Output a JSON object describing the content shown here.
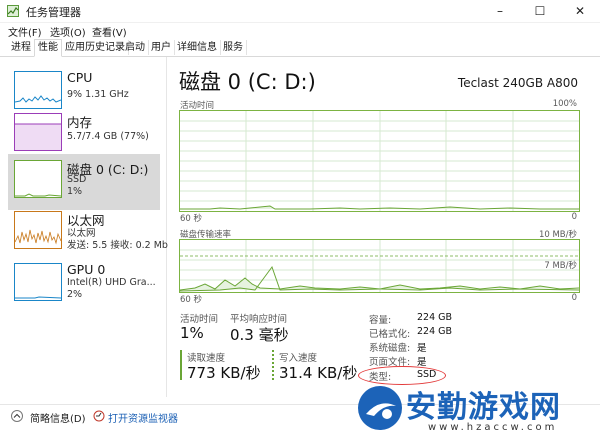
{
  "window": {
    "title": "任务管理器",
    "controls": [
      "–",
      "☐",
      "✕"
    ]
  },
  "menu": [
    "文件(F)",
    "选项(O)",
    "查看(V)"
  ],
  "tabs": [
    "进程",
    "性能",
    "应用历史记录",
    "启动",
    "用户",
    "详细信息",
    "服务"
  ],
  "active_tab": "性能",
  "sidebar": [
    {
      "name": "CPU",
      "sub1": "9%  1.31 GHz",
      "sub2": ""
    },
    {
      "name": "内存",
      "sub1": "5.7/7.4 GB (77%)",
      "sub2": ""
    },
    {
      "name": "磁盘 0 (C: D:)",
      "sub1": "SSD",
      "sub2": "1%"
    },
    {
      "name": "以太网",
      "sub1": "以太网",
      "sub2": "发送: 5.5  接收: 0.2 Mb"
    },
    {
      "name": "GPU 0",
      "sub1": "Intel(R) UHD Gra...",
      "sub2": "2%"
    }
  ],
  "main": {
    "title": "磁盘 0 (C: D:)",
    "device": "Teclast 240GB A800",
    "graph1": {
      "label": "活动时间",
      "max": "100%",
      "left": "60 秒",
      "right": "0"
    },
    "graph2": {
      "label": "磁盘传输速率",
      "max": "10 MB/秒",
      "mid": "7 MB/秒",
      "left": "60 秒",
      "right": "0"
    },
    "active_time_label": "活动时间",
    "active_time_value": "1%",
    "avg_response_label": "平均响应时间",
    "avg_response_value": "0.3 毫秒",
    "read_label": "读取速度",
    "read_value": "773 KB/秒",
    "write_label": "写入速度",
    "write_value": "31.4 KB/秒",
    "props": [
      {
        "k": "容量:",
        "v": "224 GB"
      },
      {
        "k": "已格式化:",
        "v": "224 GB"
      },
      {
        "k": "系统磁盘:",
        "v": "是"
      },
      {
        "k": "页面文件:",
        "v": "是"
      },
      {
        "k": "类型:",
        "v": "SSD"
      }
    ]
  },
  "bottom": {
    "summary": "简略信息(D)",
    "resmon": "打开资源监视器"
  },
  "watermark": {
    "text": "安勤游戏网",
    "url": "www.hzaccw.com"
  },
  "colors": {
    "disk_accent": "#6aa636",
    "cpu_accent": "#1a86c8",
    "mem_accent": "#9b3db8",
    "net_accent": "#c8781a",
    "highlight_circle": "#e33a3a"
  }
}
